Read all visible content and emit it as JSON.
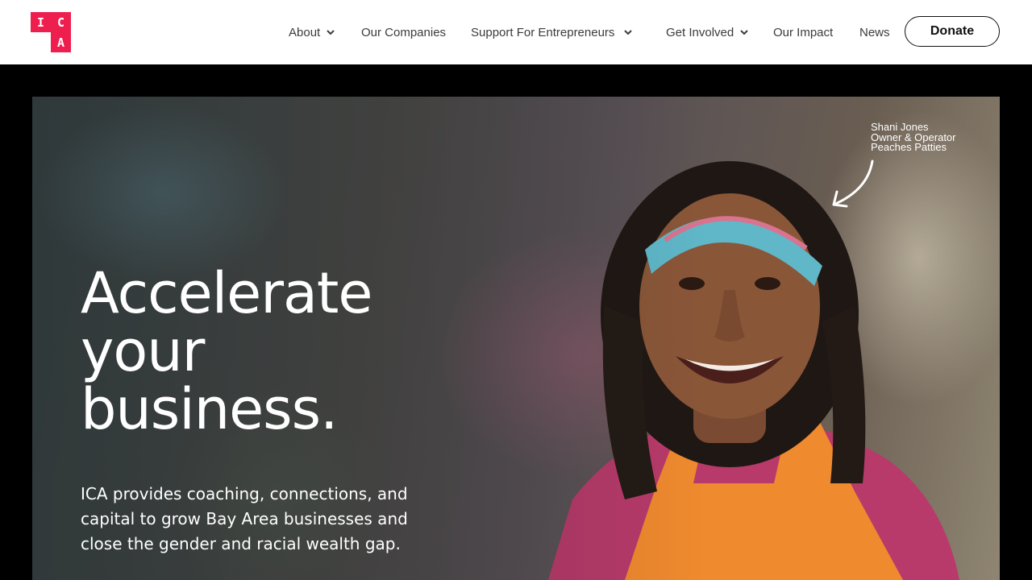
{
  "header": {
    "logo": {
      "letters": [
        "I",
        "C",
        "A"
      ],
      "color": "#ee1e4f"
    },
    "nav": [
      {
        "label": "About",
        "has_dropdown": true
      },
      {
        "label": "Our Companies",
        "has_dropdown": false
      },
      {
        "label": "Support For Entrepreneurs",
        "has_dropdown": true
      },
      {
        "label": "Get Involved",
        "has_dropdown": true
      },
      {
        "label": "Our Impact",
        "has_dropdown": false
      },
      {
        "label": "News",
        "has_dropdown": false
      }
    ],
    "donate_label": "Donate"
  },
  "hero": {
    "headline": [
      "Accelerate",
      "your",
      "business."
    ],
    "subtext": "ICA provides coaching, connections, and capital to grow Bay Area businesses and close the gender and racial wealth gap.",
    "caption": {
      "name": "Shani Jones",
      "role": "Owner & Operator",
      "company": "Peaches Patties"
    }
  },
  "colors": {
    "brand": "#ee1e4f",
    "header_bg": "#ffffff",
    "page_bg": "#000000"
  }
}
